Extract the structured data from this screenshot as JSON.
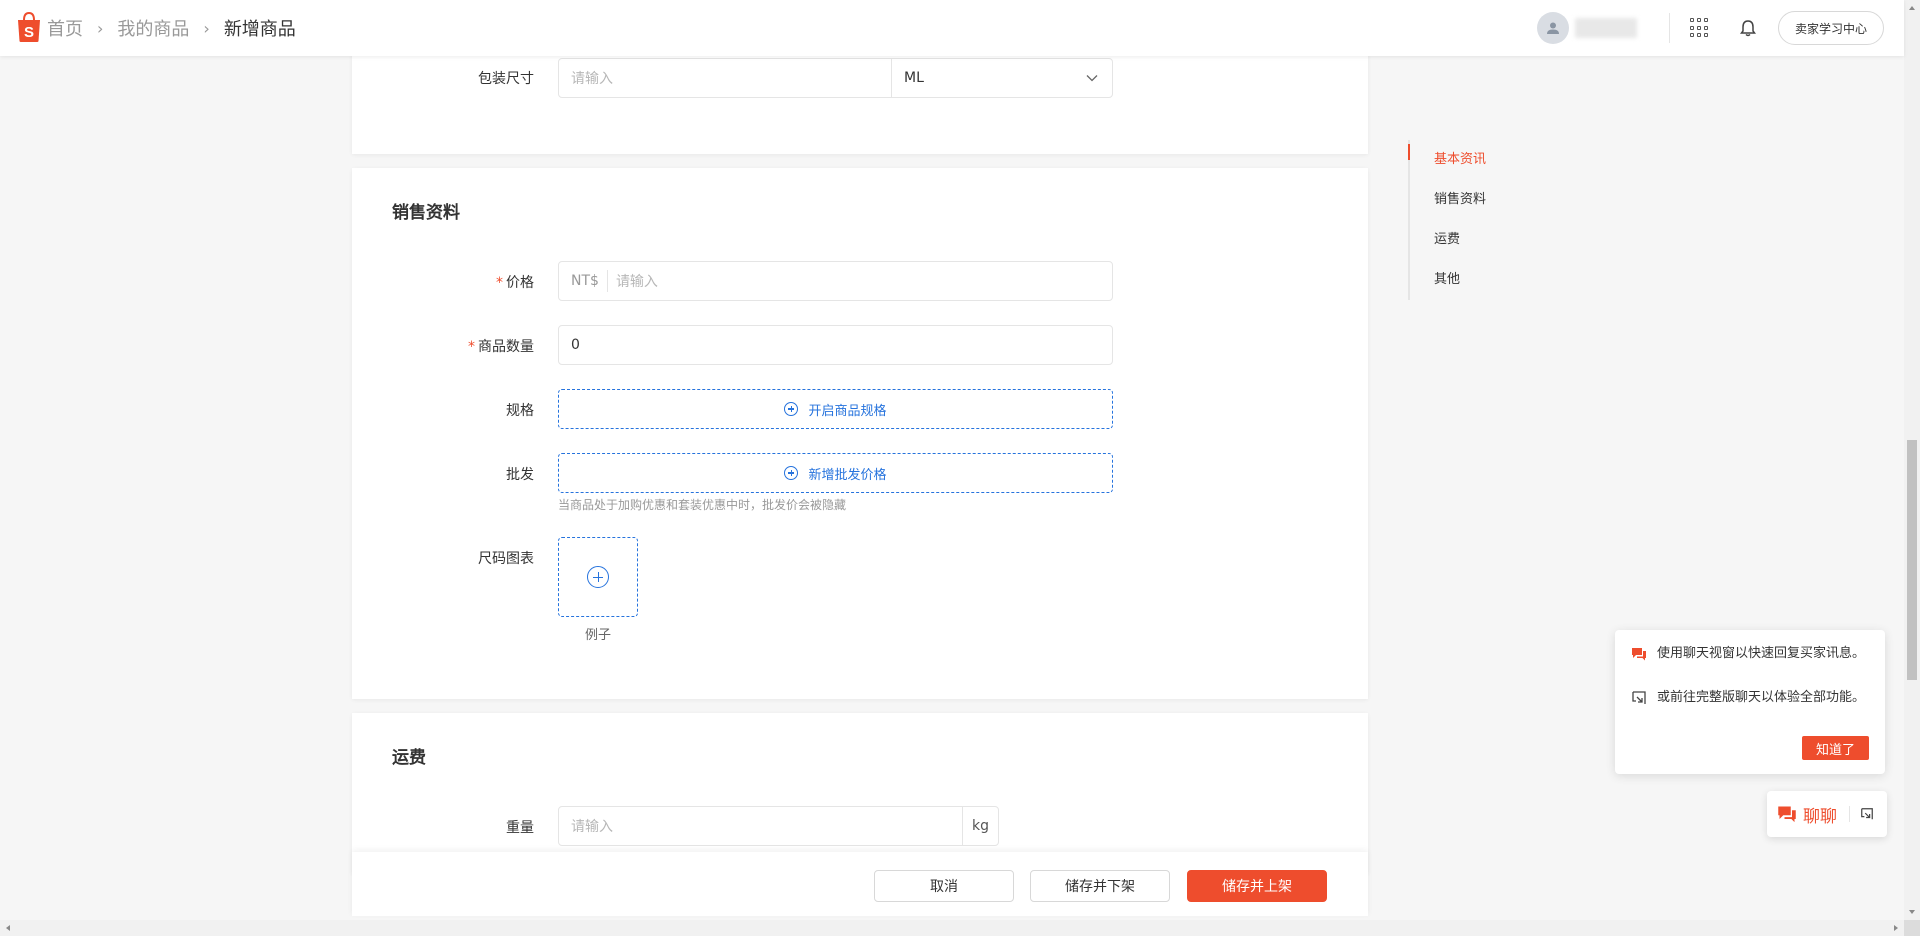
{
  "header": {
    "breadcrumbs": [
      "首页",
      "我的商品",
      "新增商品"
    ],
    "seller_center_label": "卖家学习中心"
  },
  "package_card": {
    "size_label": "包装尺寸",
    "size_placeholder": "请输入",
    "unit_value": "ML"
  },
  "sales_card": {
    "title": "销售资料",
    "price_label": "价格",
    "price_prefix": "NT$",
    "price_placeholder": "请输入",
    "quantity_label": "商品数量",
    "quantity_value": "0",
    "variation_label": "规格",
    "variation_button": "开启商品规格",
    "wholesale_label": "批发",
    "wholesale_button": "新增批发价格",
    "wholesale_hint": "当商品处于加购优惠和套装优惠中时，批发价会被隐藏",
    "size_chart_label": "尺码图表",
    "size_chart_caption": "例子"
  },
  "shipping_card": {
    "title": "运费",
    "weight_label": "重量",
    "weight_placeholder": "请输入",
    "weight_unit": "kg"
  },
  "anchor_nav": {
    "items": [
      "基本资讯",
      "销售资料",
      "运费",
      "其他"
    ],
    "active": "基本资讯"
  },
  "actions": {
    "cancel": "取消",
    "save_delist": "储存并下架",
    "save_publish": "储存并上架"
  },
  "chat": {
    "tip1": "使用聊天视窗以快速回复买家讯息。",
    "tip2": "或前往完整版聊天以体验全部功能。",
    "got_it": "知道了",
    "chat_label": "聊聊"
  },
  "colors": {
    "brand": "#ee4d2d",
    "link_blue": "#2673dd"
  }
}
